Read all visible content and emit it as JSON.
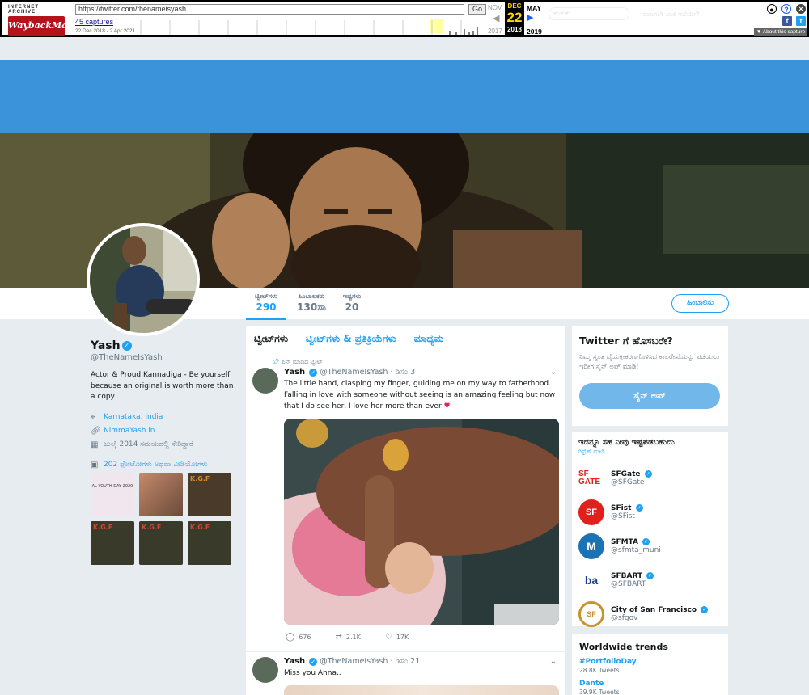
{
  "wayback": {
    "logo_top": "INTERNET ARCHIVE",
    "logo_main": "WaybackMachine",
    "url": "https://twitter.com/thenameisyash",
    "go_label": "Go",
    "captures": "45 captures",
    "range": "22 Dec 2018 - 2 Apr 2021",
    "prev_month": "NOV",
    "prev_year": "2017",
    "cur_month": "DEC",
    "cur_day": "22",
    "cur_year": "2018",
    "next_month": "MAY",
    "next_year": "2019",
    "about": "▼ About this capture",
    "ghost_search": "ಹುಡುಕು",
    "ghost_lang": "ಈಗಾಗಲೇ ಖಾತೆ ಇದೆಯೇ?"
  },
  "nav": {
    "tweets_label": "ಟ್ವೀಟ್‌ಗಳು",
    "tweets_value": "290",
    "following_label": "ಹಿಂಬಾಲಕರು",
    "following_value": "130ಸಾ",
    "likes_label": "ಇಷ್ಟಗಳು",
    "likes_value": "20",
    "follow_button": "ಹಿಂಬಾಲಿಸು"
  },
  "profile": {
    "name": "Yash",
    "handle": "@TheNameIsYash",
    "bio": "Actor & Proud Kannadiga - Be yourself because an original is worth more than a copy",
    "location": "Karnataka, India",
    "website": "NimmaYash.in",
    "joined": "ಜುಲೈ 2014 ಸಮಯದಲ್ಲಿ ಸೇರಿದ್ದಾರೆ",
    "media_link": "202 ಫೋಟೋಗಳು ಅಥವಾ ವೀಡಿಯೋಗಳು",
    "thumb_texts": [
      "AL YOUTH DAY 2020",
      "",
      "K.G.F",
      "K.G.F",
      "K.G.F",
      "K.G.F"
    ]
  },
  "timeline": {
    "tabs": [
      "ಟ್ವೀಟ್‌ಗಳು",
      "ಟ್ವೀಟ್‌ಗಳು & ಪ್ರತಿಕ್ರಿಯೆಗಳು",
      "ಮಾಧ್ಯಮ"
    ],
    "pinned": "ಪಿನ್ ಮಾಡಿದ ಟ್ವೀಟ್",
    "tweet1": {
      "name": "Yash",
      "handle": "@TheNameIsYash",
      "date": "· ಡಿಸೆಂ 3",
      "text": "The little hand, clasping my finger, guiding me on my way to fatherhood. Falling in love with someone without seeing is an amazing feeling but now that I do see her, I love her more than ever",
      "replies": "676",
      "retweets": "2.1K",
      "likes": "17K"
    },
    "tweet2": {
      "name": "Yash",
      "handle": "@TheNameIsYash",
      "date": "· ಡಿಸೆಂ 21",
      "text": "Miss you Anna.."
    }
  },
  "signup": {
    "title": "Twitter ಗೆ ಹೊಸಬರೇ?",
    "desc": "ನಿಮ್ಮ ಸ್ವಂತ ವೈಯಕ್ತೀಕರಣಗೊಳಿಸಿದ ಕಾಲರೇಖೆಯನ್ನು ಪಡೆಯಲು ಇದೀಗ ಸೈನ್ ಅಪ್ ಮಾಡಿ!",
    "button": "ಸೈನ್ ಅಪ್"
  },
  "who_to_follow": {
    "title": "ಇದನ್ನೂ ಸಹ ನೀವು ಇಷ್ಟಪಡಬಹುದು",
    "refresh": "ರಿಫ್ರೆಶ್ ಮಾಡಿ",
    "accounts": [
      {
        "name": "SFGate",
        "handle": "@SFGate",
        "logo": "SF GATE",
        "color": "#e0201b"
      },
      {
        "name": "SFist",
        "handle": "@SFist",
        "logo": "SF",
        "color": "#e0201b"
      },
      {
        "name": "SFMTA",
        "handle": "@sfmta_muni",
        "logo": "M",
        "color": "#1b73b3"
      },
      {
        "name": "SFBART",
        "handle": "@SFBART",
        "logo": "ba",
        "color": "#1b3f8f"
      },
      {
        "name": "City of San Francisco",
        "handle": "@sfgov",
        "logo": "SF",
        "color": "#c9922b"
      }
    ]
  },
  "trends": {
    "title": "Worldwide trends",
    "items": [
      {
        "name": "#PortfolioDay",
        "count": "28.8K Tweets"
      },
      {
        "name": "Dante",
        "count": "39.9K Tweets"
      }
    ]
  },
  "colors": {
    "accent": "#1da1f2",
    "banner": "#3b94d9",
    "bg": "#e6ecf0"
  }
}
